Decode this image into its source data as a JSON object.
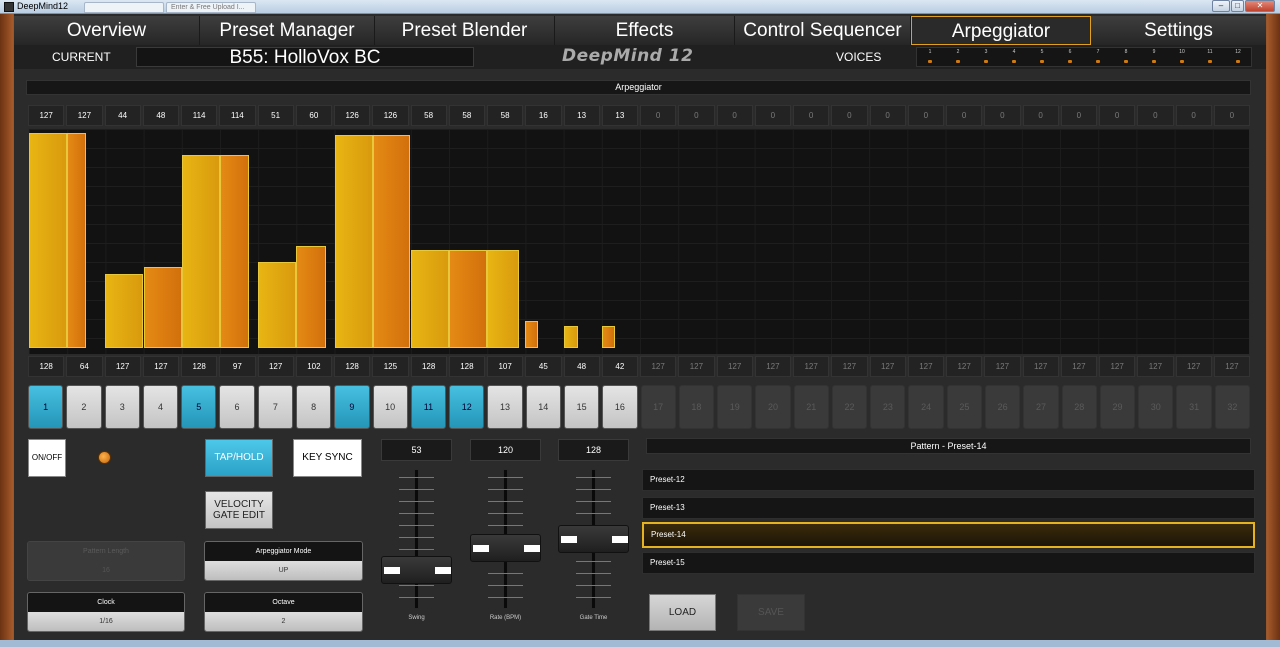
{
  "window": {
    "title": "DeepMind12",
    "ghost_tabs": [
      "",
      "Enter & Free Upload I..."
    ],
    "controls": [
      "–",
      "□",
      "✕"
    ]
  },
  "nav": {
    "tabs": [
      {
        "label": "Overview",
        "active": false
      },
      {
        "label": "Preset Manager",
        "active": false
      },
      {
        "label": "Preset Blender",
        "active": false
      },
      {
        "label": "Effects",
        "active": false
      },
      {
        "label": "Control Sequencer",
        "active": false
      },
      {
        "label": "Arpeggiator",
        "active": true
      },
      {
        "label": "Settings",
        "active": false
      }
    ]
  },
  "header": {
    "current_label": "CURRENT",
    "preset_name": "B55: HolloVox BC",
    "logo": "DeepMind 12",
    "voices_label": "VOICES",
    "voice_numbers": [
      "1",
      "2",
      "3",
      "4",
      "5",
      "6",
      "7",
      "8",
      "9",
      "10",
      "11",
      "12"
    ]
  },
  "arp": {
    "title": "Arpeggiator",
    "velocities": [
      "127",
      "127",
      "44",
      "48",
      "114",
      "114",
      "51",
      "60",
      "126",
      "126",
      "58",
      "58",
      "58",
      "16",
      "13",
      "13",
      "0",
      "0",
      "0",
      "0",
      "0",
      "0",
      "0",
      "0",
      "0",
      "0",
      "0",
      "0",
      "0",
      "0",
      "0",
      "0"
    ],
    "gates": [
      "128",
      "64",
      "127",
      "127",
      "128",
      "97",
      "127",
      "102",
      "128",
      "125",
      "128",
      "128",
      "107",
      "45",
      "48",
      "42",
      "127",
      "127",
      "127",
      "127",
      "127",
      "127",
      "127",
      "127",
      "127",
      "127",
      "127",
      "127",
      "127",
      "127",
      "127",
      "127"
    ],
    "active_steps": 16,
    "steps": [
      "1",
      "2",
      "3",
      "4",
      "5",
      "6",
      "7",
      "8",
      "9",
      "10",
      "11",
      "12",
      "13",
      "14",
      "15",
      "16",
      "17",
      "18",
      "19",
      "20",
      "21",
      "22",
      "23",
      "24",
      "25",
      "26",
      "27",
      "28",
      "29",
      "30",
      "31",
      "32"
    ],
    "highlighted_steps": [
      1,
      5,
      9,
      11,
      12
    ],
    "colors": {
      "velocity": "#e8b513",
      "gate": "#e07a10",
      "step_on": "#3ab0d6"
    }
  },
  "controls": {
    "onoff": "ON/OFF",
    "tap_hold": "TAP/HOLD",
    "key_sync": "KEY SYNC",
    "velocity_gate_edit_1": "VELOCITY",
    "velocity_gate_edit_2": "GATE EDIT",
    "pattern_length": {
      "label": "Pattern Length",
      "value": "16"
    },
    "arp_mode": {
      "label": "Arpeggiator Mode",
      "value": "UP"
    },
    "clock": {
      "label": "Clock",
      "value": "1/16"
    },
    "octave": {
      "label": "Octave",
      "value": "2"
    }
  },
  "faders": [
    {
      "label": "Swing",
      "value": "53",
      "level": 0.22
    },
    {
      "label": "Rate (BPM)",
      "value": "120",
      "level": 0.42
    },
    {
      "label": "Gate Time",
      "value": "128",
      "level": 0.5
    }
  ],
  "patterns": {
    "title": "Pattern - Preset-14",
    "items": [
      {
        "label": "Preset-12",
        "selected": false
      },
      {
        "label": "Preset-13",
        "selected": false
      },
      {
        "label": "Preset-14",
        "selected": true
      },
      {
        "label": "Preset-15",
        "selected": false
      }
    ],
    "load": "LOAD",
    "save": "SAVE"
  }
}
